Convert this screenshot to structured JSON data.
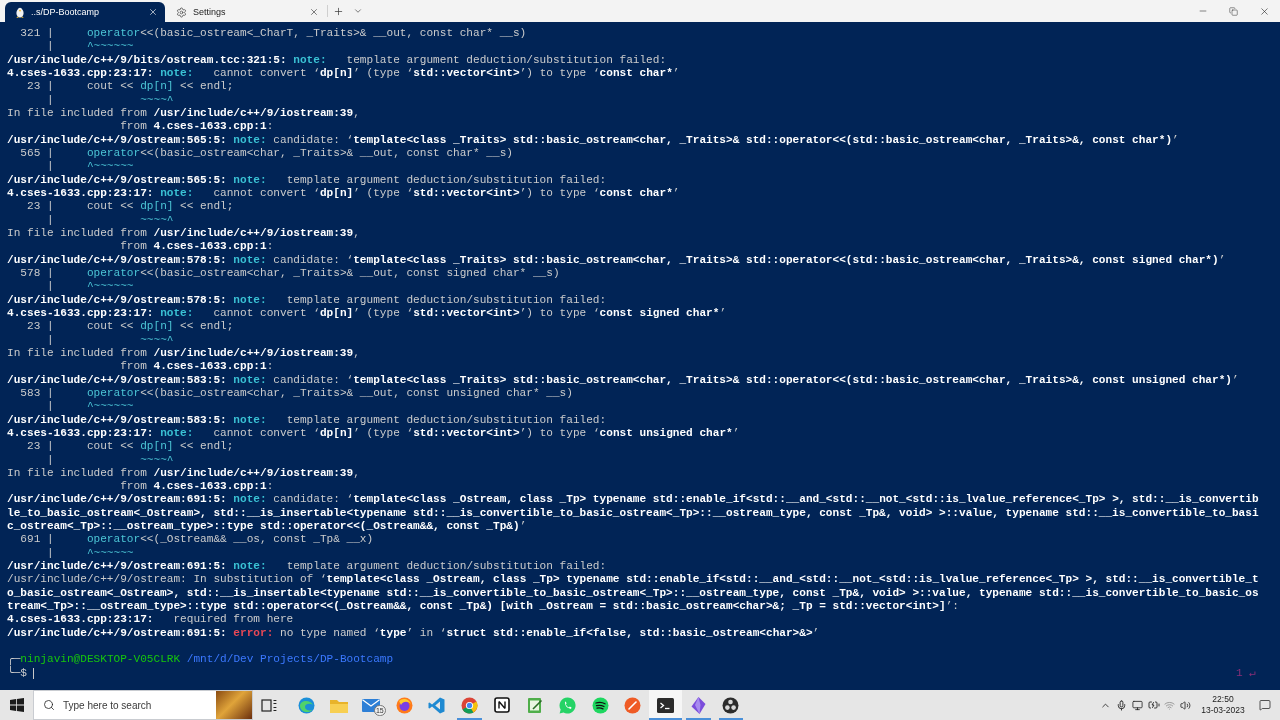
{
  "window": {
    "tabs": [
      {
        "kind": "terminal",
        "label": "..s/DP-Bootcamp",
        "selected": true
      },
      {
        "kind": "settings",
        "label": "Settings",
        "selected": false
      }
    ]
  },
  "terminal": {
    "lines": [
      {
        "segments": [
          {
            "kind": "plain",
            "text": "  321 |     "
          },
          {
            "kind": "highlight",
            "text": "operator"
          },
          {
            "kind": "plain",
            "text": "<<(basic_ostream<_CharT, _Traits>& __out, const char* __s)"
          }
        ]
      },
      {
        "segments": [
          {
            "kind": "plain",
            "text": "      |     "
          },
          {
            "kind": "highlight",
            "text": "^~~~~~~"
          }
        ]
      },
      {
        "segments": [
          {
            "kind": "bold",
            "text": "/usr/include/c++/9/bits/ostream.tcc:321:5:"
          },
          {
            "kind": "note",
            "text": " note:"
          },
          {
            "kind": "plain",
            "text": "   template argument deduction/substitution failed:"
          }
        ]
      },
      {
        "segments": [
          {
            "kind": "bold",
            "text": "4.cses-1633.cpp:23:17:"
          },
          {
            "kind": "note",
            "text": " note:"
          },
          {
            "kind": "plain",
            "text": "   cannot convert ‘"
          },
          {
            "kind": "bold",
            "text": "dp[n]"
          },
          {
            "kind": "plain",
            "text": "’ (type ‘"
          },
          {
            "kind": "bold",
            "text": "std::vector<int>"
          },
          {
            "kind": "plain",
            "text": "’) to type ‘"
          },
          {
            "kind": "bold",
            "text": "const char*"
          },
          {
            "kind": "plain",
            "text": "’"
          }
        ]
      },
      {
        "segments": [
          {
            "kind": "plain",
            "text": "   23 |     cout << "
          },
          {
            "kind": "highlight",
            "text": "dp[n]"
          },
          {
            "kind": "plain",
            "text": " << endl;"
          }
        ]
      },
      {
        "segments": [
          {
            "kind": "plain",
            "text": "      |             "
          },
          {
            "kind": "highlight",
            "text": "~~~~^"
          }
        ]
      },
      {
        "segments": [
          {
            "kind": "plain",
            "text": "In file included from "
          },
          {
            "kind": "bold",
            "text": "/usr/include/c++/9/iostream:39"
          },
          {
            "kind": "plain",
            "text": ","
          }
        ]
      },
      {
        "segments": [
          {
            "kind": "plain",
            "text": "                 from "
          },
          {
            "kind": "bold",
            "text": "4.cses-1633.cpp:1"
          },
          {
            "kind": "plain",
            "text": ":"
          }
        ]
      },
      {
        "segments": [
          {
            "kind": "bold",
            "text": "/usr/include/c++/9/ostream:565:5:"
          },
          {
            "kind": "note",
            "text": " note:"
          },
          {
            "kind": "plain",
            "text": " candidate: ‘"
          },
          {
            "kind": "bold",
            "text": "template<class _Traits> std::basic_ostream<char, _Traits>& std::operator<<(std::basic_ostream<char, _Traits>&, const char*)"
          },
          {
            "kind": "plain",
            "text": "’"
          }
        ]
      },
      {
        "segments": [
          {
            "kind": "plain",
            "text": "  565 |     "
          },
          {
            "kind": "highlight",
            "text": "operator"
          },
          {
            "kind": "plain",
            "text": "<<(basic_ostream<char, _Traits>& __out, const char* __s)"
          }
        ]
      },
      {
        "segments": [
          {
            "kind": "plain",
            "text": "      |     "
          },
          {
            "kind": "highlight",
            "text": "^~~~~~~"
          }
        ]
      },
      {
        "segments": [
          {
            "kind": "bold",
            "text": "/usr/include/c++/9/ostream:565:5:"
          },
          {
            "kind": "note",
            "text": " note:"
          },
          {
            "kind": "plain",
            "text": "   template argument deduction/substitution failed:"
          }
        ]
      },
      {
        "segments": [
          {
            "kind": "bold",
            "text": "4.cses-1633.cpp:23:17:"
          },
          {
            "kind": "note",
            "text": " note:"
          },
          {
            "kind": "plain",
            "text": "   cannot convert ‘"
          },
          {
            "kind": "bold",
            "text": "dp[n]"
          },
          {
            "kind": "plain",
            "text": "’ (type ‘"
          },
          {
            "kind": "bold",
            "text": "std::vector<int>"
          },
          {
            "kind": "plain",
            "text": "’) to type ‘"
          },
          {
            "kind": "bold",
            "text": "const char*"
          },
          {
            "kind": "plain",
            "text": "’"
          }
        ]
      },
      {
        "segments": [
          {
            "kind": "plain",
            "text": "   23 |     cout << "
          },
          {
            "kind": "highlight",
            "text": "dp[n]"
          },
          {
            "kind": "plain",
            "text": " << endl;"
          }
        ]
      },
      {
        "segments": [
          {
            "kind": "plain",
            "text": "      |             "
          },
          {
            "kind": "highlight",
            "text": "~~~~^"
          }
        ]
      },
      {
        "segments": [
          {
            "kind": "plain",
            "text": "In file included from "
          },
          {
            "kind": "bold",
            "text": "/usr/include/c++/9/iostream:39"
          },
          {
            "kind": "plain",
            "text": ","
          }
        ]
      },
      {
        "segments": [
          {
            "kind": "plain",
            "text": "                 from "
          },
          {
            "kind": "bold",
            "text": "4.cses-1633.cpp:1"
          },
          {
            "kind": "plain",
            "text": ":"
          }
        ]
      },
      {
        "segments": [
          {
            "kind": "bold",
            "text": "/usr/include/c++/9/ostream:578:5:"
          },
          {
            "kind": "note",
            "text": " note:"
          },
          {
            "kind": "plain",
            "text": " candidate: ‘"
          },
          {
            "kind": "bold",
            "text": "template<class _Traits> std::basic_ostream<char, _Traits>& std::operator<<(std::basic_ostream<char, _Traits>&, const signed char*)"
          },
          {
            "kind": "plain",
            "text": "’"
          }
        ]
      },
      {
        "segments": [
          {
            "kind": "plain",
            "text": "  578 |     "
          },
          {
            "kind": "highlight",
            "text": "operator"
          },
          {
            "kind": "plain",
            "text": "<<(basic_ostream<char, _Traits>& __out, const signed char* __s)"
          }
        ]
      },
      {
        "segments": [
          {
            "kind": "plain",
            "text": "      |     "
          },
          {
            "kind": "highlight",
            "text": "^~~~~~~"
          }
        ]
      },
      {
        "segments": [
          {
            "kind": "bold",
            "text": "/usr/include/c++/9/ostream:578:5:"
          },
          {
            "kind": "note",
            "text": " note:"
          },
          {
            "kind": "plain",
            "text": "   template argument deduction/substitution failed:"
          }
        ]
      },
      {
        "segments": [
          {
            "kind": "bold",
            "text": "4.cses-1633.cpp:23:17:"
          },
          {
            "kind": "note",
            "text": " note:"
          },
          {
            "kind": "plain",
            "text": "   cannot convert ‘"
          },
          {
            "kind": "bold",
            "text": "dp[n]"
          },
          {
            "kind": "plain",
            "text": "’ (type ‘"
          },
          {
            "kind": "bold",
            "text": "std::vector<int>"
          },
          {
            "kind": "plain",
            "text": "’) to type ‘"
          },
          {
            "kind": "bold",
            "text": "const signed char*"
          },
          {
            "kind": "plain",
            "text": "’"
          }
        ]
      },
      {
        "segments": [
          {
            "kind": "plain",
            "text": "   23 |     cout << "
          },
          {
            "kind": "highlight",
            "text": "dp[n]"
          },
          {
            "kind": "plain",
            "text": " << endl;"
          }
        ]
      },
      {
        "segments": [
          {
            "kind": "plain",
            "text": "      |             "
          },
          {
            "kind": "highlight",
            "text": "~~~~^"
          }
        ]
      },
      {
        "segments": [
          {
            "kind": "plain",
            "text": "In file included from "
          },
          {
            "kind": "bold",
            "text": "/usr/include/c++/9/iostream:39"
          },
          {
            "kind": "plain",
            "text": ","
          }
        ]
      },
      {
        "segments": [
          {
            "kind": "plain",
            "text": "                 from "
          },
          {
            "kind": "bold",
            "text": "4.cses-1633.cpp:1"
          },
          {
            "kind": "plain",
            "text": ":"
          }
        ]
      },
      {
        "segments": [
          {
            "kind": "bold",
            "text": "/usr/include/c++/9/ostream:583:5:"
          },
          {
            "kind": "note",
            "text": " note:"
          },
          {
            "kind": "plain",
            "text": " candidate: ‘"
          },
          {
            "kind": "bold",
            "text": "template<class _Traits> std::basic_ostream<char, _Traits>& std::operator<<(std::basic_ostream<char, _Traits>&, const unsigned char*)"
          },
          {
            "kind": "plain",
            "text": "’"
          }
        ]
      },
      {
        "segments": [
          {
            "kind": "plain",
            "text": "  583 |     "
          },
          {
            "kind": "highlight",
            "text": "operator"
          },
          {
            "kind": "plain",
            "text": "<<(basic_ostream<char, _Traits>& __out, const unsigned char* __s)"
          }
        ]
      },
      {
        "segments": [
          {
            "kind": "plain",
            "text": "      |     "
          },
          {
            "kind": "highlight",
            "text": "^~~~~~~"
          }
        ]
      },
      {
        "segments": [
          {
            "kind": "bold",
            "text": "/usr/include/c++/9/ostream:583:5:"
          },
          {
            "kind": "note",
            "text": " note:"
          },
          {
            "kind": "plain",
            "text": "   template argument deduction/substitution failed:"
          }
        ]
      },
      {
        "segments": [
          {
            "kind": "bold",
            "text": "4.cses-1633.cpp:23:17:"
          },
          {
            "kind": "note",
            "text": " note:"
          },
          {
            "kind": "plain",
            "text": "   cannot convert ‘"
          },
          {
            "kind": "bold",
            "text": "dp[n]"
          },
          {
            "kind": "plain",
            "text": "’ (type ‘"
          },
          {
            "kind": "bold",
            "text": "std::vector<int>"
          },
          {
            "kind": "plain",
            "text": "’) to type ‘"
          },
          {
            "kind": "bold",
            "text": "const unsigned char*"
          },
          {
            "kind": "plain",
            "text": "’"
          }
        ]
      },
      {
        "segments": [
          {
            "kind": "plain",
            "text": "   23 |     cout << "
          },
          {
            "kind": "highlight",
            "text": "dp[n]"
          },
          {
            "kind": "plain",
            "text": " << endl;"
          }
        ]
      },
      {
        "segments": [
          {
            "kind": "plain",
            "text": "      |             "
          },
          {
            "kind": "highlight",
            "text": "~~~~^"
          }
        ]
      },
      {
        "segments": [
          {
            "kind": "plain",
            "text": "In file included from "
          },
          {
            "kind": "bold",
            "text": "/usr/include/c++/9/iostream:39"
          },
          {
            "kind": "plain",
            "text": ","
          }
        ]
      },
      {
        "segments": [
          {
            "kind": "plain",
            "text": "                 from "
          },
          {
            "kind": "bold",
            "text": "4.cses-1633.cpp:1"
          },
          {
            "kind": "plain",
            "text": ":"
          }
        ]
      },
      {
        "segments": [
          {
            "kind": "bold",
            "text": "/usr/include/c++/9/ostream:691:5:"
          },
          {
            "kind": "note",
            "text": " note:"
          },
          {
            "kind": "plain",
            "text": " candidate: ‘"
          },
          {
            "kind": "bold",
            "text": "template<class _Ostream, class _Tp> typename std::enable_if<std::__and_<std::__not_<std::is_lvalue_reference<_Tp> >, std::__is_convertib"
          }
        ]
      },
      {
        "segments": [
          {
            "kind": "bold",
            "text": "le_to_basic_ostream<_Ostream>, std::__is_insertable<typename std::__is_convertible_to_basic_ostream<_Tp>::__ostream_type, const _Tp&, void> >::value, typename std::__is_convertible_to_basi"
          }
        ]
      },
      {
        "segments": [
          {
            "kind": "bold",
            "text": "c_ostream<_Tp>::__ostream_type>::type std::operator<<(_Ostream&&, const _Tp&)"
          },
          {
            "kind": "plain",
            "text": "’"
          }
        ]
      },
      {
        "segments": [
          {
            "kind": "plain",
            "text": "  691 |     "
          },
          {
            "kind": "highlight",
            "text": "operator"
          },
          {
            "kind": "plain",
            "text": "<<(_Ostream&& __os, const _Tp& __x)"
          }
        ]
      },
      {
        "segments": [
          {
            "kind": "plain",
            "text": "      |     "
          },
          {
            "kind": "highlight",
            "text": "^~~~~~~"
          }
        ]
      },
      {
        "segments": [
          {
            "kind": "bold",
            "text": "/usr/include/c++/9/ostream:691:5:"
          },
          {
            "kind": "note",
            "text": " note:"
          },
          {
            "kind": "plain",
            "text": "   template argument deduction/substitution failed:"
          }
        ]
      },
      {
        "segments": [
          {
            "kind": "plain",
            "text": "/usr/include/c++/9/ostream: In substitution of ‘"
          },
          {
            "kind": "bold",
            "text": "template<class _Ostream, class _Tp> typename std::enable_if<std::__and_<std::__not_<std::is_lvalue_reference<_Tp> >, std::__is_convertible_t"
          }
        ]
      },
      {
        "segments": [
          {
            "kind": "bold",
            "text": "o_basic_ostream<_Ostream>, std::__is_insertable<typename std::__is_convertible_to_basic_ostream<_Tp>::__ostream_type, const _Tp&, void> >::value, typename std::__is_convertible_to_basic_os"
          }
        ]
      },
      {
        "segments": [
          {
            "kind": "bold",
            "text": "tream<_Tp>::__ostream_type>::type std::operator<<(_Ostream&&, const _Tp&) [with _Ostream = std::basic_ostream<char>&; _Tp = std::vector<int>]"
          },
          {
            "kind": "plain",
            "text": "’:"
          }
        ]
      },
      {
        "segments": [
          {
            "kind": "bold",
            "text": "4.cses-1633.cpp:23:17:"
          },
          {
            "kind": "plain",
            "text": "   required from here"
          }
        ]
      },
      {
        "segments": [
          {
            "kind": "bold",
            "text": "/usr/include/c++/9/ostream:691:5:"
          },
          {
            "kind": "error",
            "text": " error:"
          },
          {
            "kind": "plain",
            "text": " no type named ‘"
          },
          {
            "kind": "bold",
            "text": "type"
          },
          {
            "kind": "plain",
            "text": "’ in ‘"
          },
          {
            "kind": "bold",
            "text": "struct std::enable_if<false, std::basic_ostream<char>&>"
          },
          {
            "kind": "plain",
            "text": "’"
          }
        ]
      }
    ],
    "prompt": {
      "corner_top": "╭─",
      "user": "ninjavin@DESKTOP-V05CLRK",
      "path": "/mnt/d/Dev Projects/DP-Bootcamp",
      "corner_bottom": "╰─",
      "symbol": "$",
      "exit_status": "1 ↵"
    }
  },
  "taskbar": {
    "search": {
      "placeholder": "Type here to search"
    },
    "apps": [
      {
        "kind": "task_view",
        "running": false,
        "selected": false
      },
      {
        "kind": "swirl",
        "running": false,
        "selected": false
      },
      {
        "kind": "folder",
        "running": false,
        "selected": false
      },
      {
        "kind": "mail",
        "running": false,
        "selected": false,
        "badge": "15"
      },
      {
        "kind": "flame_globe",
        "running": false,
        "selected": false
      },
      {
        "kind": "ribbon",
        "running": false,
        "selected": false
      },
      {
        "kind": "segmented_circle",
        "running": true,
        "selected": false
      },
      {
        "kind": "framed_square",
        "running": false,
        "selected": false
      },
      {
        "kind": "notepad",
        "running": false,
        "selected": false
      },
      {
        "kind": "chat",
        "running": false,
        "selected": false
      },
      {
        "kind": "arcs",
        "running": false,
        "selected": false
      },
      {
        "kind": "slashed_circle",
        "running": false,
        "selected": false
      },
      {
        "kind": "terminal",
        "running": true,
        "selected": true
      },
      {
        "kind": "gem",
        "running": true,
        "selected": false
      },
      {
        "kind": "orb",
        "running": true,
        "selected": false
      }
    ],
    "clock": {
      "time": "22:50",
      "date": "13-03-2023"
    }
  }
}
